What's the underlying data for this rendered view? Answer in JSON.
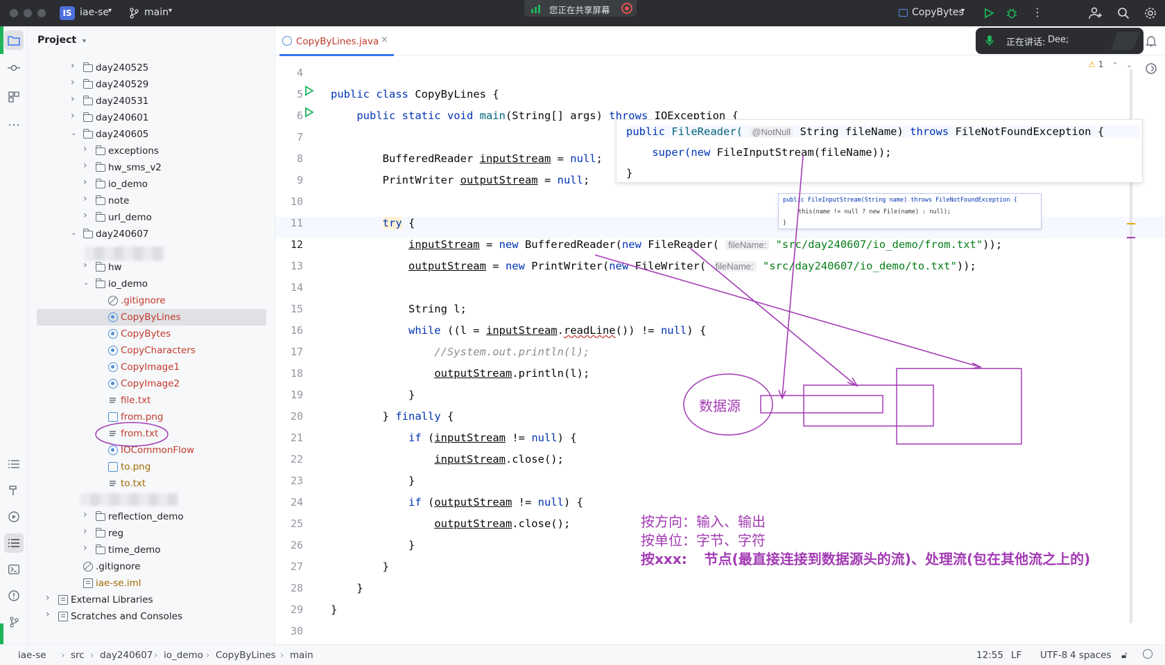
{
  "titlebar": {
    "project_badge": "IS",
    "project": "iae-se",
    "branch": "main",
    "sharing": "您正在共享屏幕",
    "run_config": "CopyBytes"
  },
  "voice": {
    "label": "正在讲话:",
    "speaker": "Dee;"
  },
  "panel": {
    "title": "Project",
    "tree": [
      {
        "label": "day240525",
        "color": "#1e1f22"
      },
      {
        "label": "day240529",
        "color": "#1e1f22"
      },
      {
        "label": "day240531",
        "color": "#1e1f22"
      },
      {
        "label": "day240601",
        "color": "#1e1f22"
      },
      {
        "label": "day240605",
        "color": "#1e1f22"
      },
      {
        "label": "exceptions",
        "color": "#1e1f22"
      },
      {
        "label": "hw_sms_v2",
        "color": "#1e1f22"
      },
      {
        "label": "io_demo",
        "color": "#1e1f22"
      },
      {
        "label": "note",
        "color": "#1e1f22"
      },
      {
        "label": "url_demo",
        "color": "#1e1f22"
      },
      {
        "label": "day240607",
        "color": "#1e1f22"
      },
      {
        "label": "",
        "color": "#1e1f22"
      },
      {
        "label": "hw",
        "color": "#1e1f22"
      },
      {
        "label": "io_demo",
        "color": "#1e1f22"
      },
      {
        "label": ".gitignore",
        "color": "#c0392b"
      },
      {
        "label": "CopyByLines",
        "color": "#c0392b"
      },
      {
        "label": "CopyBytes",
        "color": "#c0392b"
      },
      {
        "label": "CopyCharacters",
        "color": "#c0392b"
      },
      {
        "label": "CopyImage1",
        "color": "#c0392b"
      },
      {
        "label": "CopyImage2",
        "color": "#c0392b"
      },
      {
        "label": "file.txt",
        "color": "#c0392b"
      },
      {
        "label": "from.png",
        "color": "#c0392b"
      },
      {
        "label": "from.txt",
        "color": "#c0392b"
      },
      {
        "label": "IOCommonFlow",
        "color": "#c0392b"
      },
      {
        "label": "to.png",
        "color": "#a06a00"
      },
      {
        "label": "to.txt",
        "color": "#a06a00"
      },
      {
        "label": "",
        "color": "#1e1f22"
      },
      {
        "label": "reflection_demo",
        "color": "#1e1f22"
      },
      {
        "label": "reg",
        "color": "#1e1f22"
      },
      {
        "label": "time_demo",
        "color": "#1e1f22"
      },
      {
        "label": ".gitignore",
        "color": "#1e1f22"
      },
      {
        "label": "iae-se.iml",
        "color": "#a06a00"
      },
      {
        "label": "External Libraries",
        "color": "#1e1f22"
      },
      {
        "label": "Scratches and Consoles",
        "color": "#1e1f22"
      }
    ]
  },
  "editor": {
    "tab": "CopyByLines.java",
    "warnings": "1",
    "line_numbers": [
      "4",
      "5",
      "6",
      "7",
      "8",
      "9",
      "10",
      "11",
      "12",
      "13",
      "14",
      "15",
      "16",
      "17",
      "18",
      "19",
      "20",
      "21",
      "22",
      "23",
      "24",
      "25",
      "26",
      "27",
      "28",
      "29",
      "30"
    ],
    "hint_param": "fileName:",
    "popup": {
      "l1_kw": "public",
      "l1_cls": "FileReader(",
      "l1_ann": "@NotNull",
      "l1_rest": "String fileName)",
      "l1_throws": "throws",
      "l1_exc": "FileNotFoundException {",
      "l2_super": "super(",
      "l2_new": "new",
      "l2_rest": "FileInputStream(fileName));",
      "l3": "}"
    },
    "popup2": {
      "l1": "public FileInputStream(String name) throws FileNotFoundException {",
      "l2": "this(name != null ? new File(name) : null);",
      "l3": "}"
    }
  },
  "annotations": {
    "circle_label": "数据源",
    "line1": "按方向：输入、输出",
    "line2": "按单位：字节、字符",
    "line3_prefix": "按xxx:",
    "line3_rest": "节点(最直接连接到数据源头的流)、处理流(包在其他流之上的)"
  },
  "statusbar": {
    "crumbs": [
      "iae-se",
      "src",
      "day240607",
      "io_demo",
      "CopyByLines",
      "main"
    ],
    "position": "12:55",
    "line_sep": "LF",
    "encoding": "UTF-8",
    "indent": "4 spaces"
  },
  "colors": {
    "annotation": "#a23bb3",
    "accent": "#3574f0",
    "keyword": "#0033b3",
    "string": "#067d17"
  }
}
